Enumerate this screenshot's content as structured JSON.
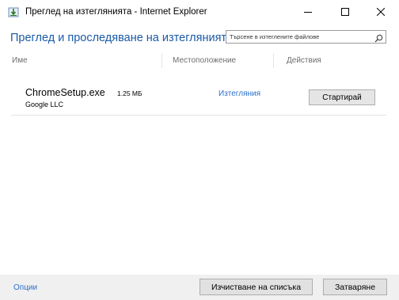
{
  "window": {
    "title": "Преглед на изтеглянията - Internet Explorer",
    "app_icon": "download-arrow-icon"
  },
  "header": {
    "title": "Преглед и проследяване на изтеглянията",
    "search_placeholder": "Търсене в изтеглените файлове",
    "search_icon": "search-icon"
  },
  "columns": {
    "name": "Име",
    "location": "Местоположение",
    "actions": "Действия"
  },
  "downloads": [
    {
      "file_name": "ChromeSetup.exe",
      "size": "1.25 МБ",
      "publisher": "Google LLC",
      "location": "Изтегляния",
      "action": "Стартирай"
    }
  ],
  "footer": {
    "options_label": "Опции",
    "clear_list_label": "Изчистване на списъка",
    "close_label": "Затваряне"
  },
  "colors": {
    "accent_blue": "#1a5aa8",
    "link_blue": "#2a6fc9",
    "footer_bg": "#f0f0f0"
  }
}
